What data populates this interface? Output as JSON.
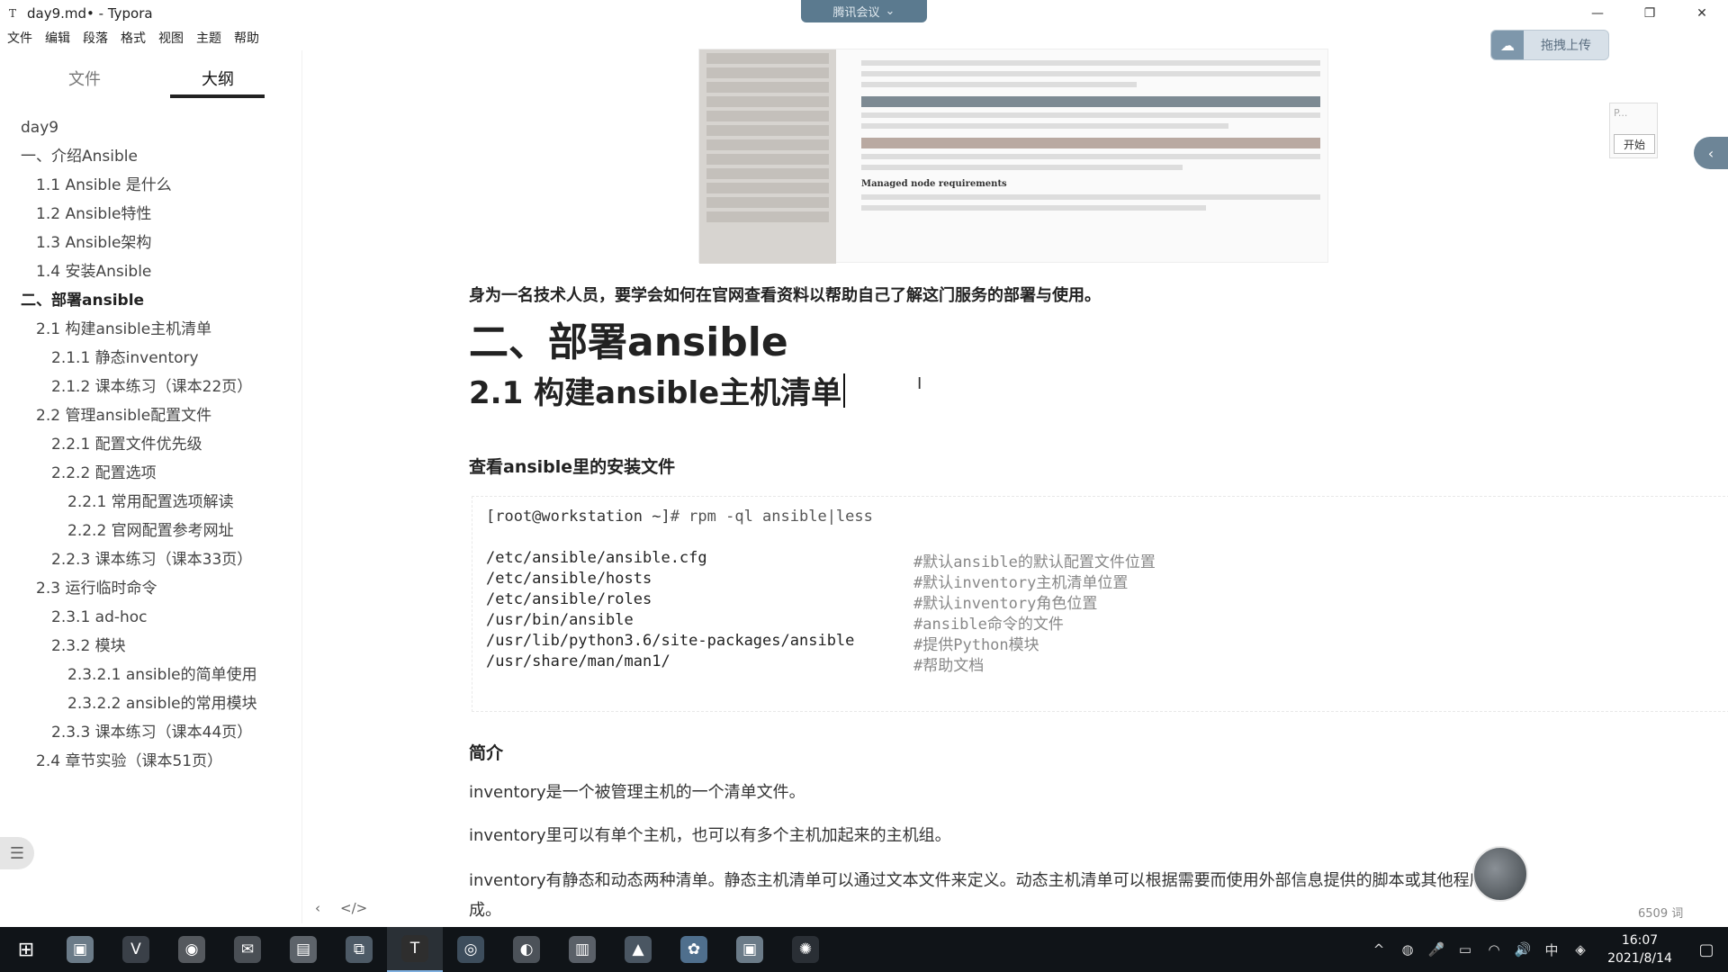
{
  "window": {
    "app_icon": "T",
    "title": "day9.md• - Typora",
    "minimize": "—",
    "maximize": "❐",
    "close": "✕"
  },
  "meeting": {
    "label": "腾讯会议",
    "chevron": "⌄"
  },
  "menubar": [
    "文件",
    "编辑",
    "段落",
    "格式",
    "视图",
    "主题",
    "帮助"
  ],
  "sidebar": {
    "tab_files": "文件",
    "tab_outline": "大纲",
    "outline": [
      {
        "label": "day9",
        "level": 0,
        "bold": false
      },
      {
        "label": "一、介绍Ansible",
        "level": 1,
        "bold": false
      },
      {
        "label": "1.1 Ansible 是什么",
        "level": 2,
        "bold": false
      },
      {
        "label": "1.2 Ansible特性",
        "level": 2,
        "bold": false
      },
      {
        "label": "1.3 Ansible架构",
        "level": 2,
        "bold": false
      },
      {
        "label": "1.4 安装Ansible",
        "level": 2,
        "bold": false
      },
      {
        "label": "二、部署ansible",
        "level": 1,
        "bold": true
      },
      {
        "label": "2.1 构建ansible主机清单",
        "level": 2,
        "bold": false
      },
      {
        "label": "2.1.1 静态inventory",
        "level": 3,
        "bold": false
      },
      {
        "label": "2.1.2 课本练习（课本22页）",
        "level": 3,
        "bold": false
      },
      {
        "label": "2.2 管理ansible配置文件",
        "level": 2,
        "bold": false
      },
      {
        "label": "2.2.1 配置文件优先级",
        "level": 3,
        "bold": false
      },
      {
        "label": "2.2.2 配置选项",
        "level": 3,
        "bold": false
      },
      {
        "label": "2.2.1 常用配置选项解读",
        "level": 4,
        "bold": false
      },
      {
        "label": "2.2.2 官网配置参考网址",
        "level": 4,
        "bold": false
      },
      {
        "label": "2.2.3 课本练习（课本33页）",
        "level": 3,
        "bold": false
      },
      {
        "label": "2.3 运行临时命令",
        "level": 2,
        "bold": false
      },
      {
        "label": "2.3.1 ad-hoc",
        "level": 3,
        "bold": false
      },
      {
        "label": "2.3.2 模块",
        "level": 3,
        "bold": false
      },
      {
        "label": "2.3.2.1 ansible的简单使用",
        "level": 4,
        "bold": false
      },
      {
        "label": "2.3.2.2 ansible的常用模块",
        "level": 4,
        "bold": false
      },
      {
        "label": "2.3.3 课本练习（课本44页）",
        "level": 3,
        "bold": false
      },
      {
        "label": "2.4 章节实验（课本51页）",
        "level": 2,
        "bold": false
      }
    ],
    "toggle_icon": "☰"
  },
  "content": {
    "embed_heading": "Managed node requirements",
    "strong_line": "身为一名技术人员，要学会如何在官网查看资料以帮助自己了解这门服务的部署与使用。",
    "h1": "二、部署ansible",
    "h2": "2.1 构建ansible主机清单",
    "cursor_glyph": "I",
    "h4": "查看ansible里的安装文件",
    "code": {
      "prompt": "[root@workstation ~]",
      "command": "# rpm -ql ansible|less",
      "rows": [
        {
          "path": "/etc/ansible/ansible.cfg",
          "comment": "#默认ansible的默认配置文件位置"
        },
        {
          "path": "/etc/ansible/hosts",
          "comment": "#默认inventory主机清单位置"
        },
        {
          "path": "/etc/ansible/roles",
          "comment": "#默认inventory角色位置"
        },
        {
          "path": "/usr/bin/ansible",
          "comment": "#ansible命令的文件"
        },
        {
          "path": "/usr/lib/python3.6/site-packages/ansible",
          "comment": "#提供Python模块"
        },
        {
          "path": "/usr/share/man/man1/",
          "comment": "#帮助文档"
        }
      ]
    },
    "h4_intro": "简介",
    "p1": "inventory是一个被管理主机的一个清单文件。",
    "p2": "inventory里可以有单个主机，也可以有多个主机加起来的主机组。",
    "p3": "inventory有静态和动态两种清单。静态主机清单可以通过文本文件来定义。动态主机清单可以根据需要而使用外部信息提供的脚本或其他程序来生成。"
  },
  "overlay": {
    "upload_icon": "☁",
    "upload_label": "拖拽上传",
    "mini_placeholder": "P...",
    "start_label": "开始",
    "edge_icon": "‹"
  },
  "footer": {
    "nav_back": "‹",
    "source_toggle": "</>",
    "wordcount": "6509 词"
  },
  "taskbar": {
    "start_icon": "⊞",
    "apps": [
      {
        "name": "app-photo",
        "glyph": "▣",
        "color": "#6b7b88"
      },
      {
        "name": "app-vivaldi",
        "glyph": "V",
        "color": "#3a4048"
      },
      {
        "name": "app-chrome",
        "glyph": "◉",
        "color": "#55595e"
      },
      {
        "name": "app-wechat",
        "glyph": "✉",
        "color": "#4a4f55"
      },
      {
        "name": "app-explorer",
        "glyph": "▤",
        "color": "#5d636a"
      },
      {
        "name": "app-vm",
        "glyph": "⧉",
        "color": "#4d5a66"
      },
      {
        "name": "app-typora",
        "glyph": "T",
        "color": "#2e2e2e"
      },
      {
        "name": "app-terminal",
        "glyph": "◎",
        "color": "#3d4d5c"
      },
      {
        "name": "app-netease",
        "glyph": "◐",
        "color": "#4c5259"
      },
      {
        "name": "app-notes",
        "glyph": "▥",
        "color": "#5a6068"
      },
      {
        "name": "app-image",
        "glyph": "▲",
        "color": "#4a5662"
      },
      {
        "name": "app-meeting",
        "glyph": "✿",
        "color": "#4f6f8d"
      },
      {
        "name": "app-photo2",
        "glyph": "▣",
        "color": "#6b7b88"
      },
      {
        "name": "app-other",
        "glyph": "✺",
        "color": "#2a2f35"
      }
    ],
    "tray": [
      "^",
      "◍",
      "🎤",
      "▭",
      "◠",
      "🔊",
      "中",
      "◈"
    ],
    "time": "16:07",
    "date": "2021/8/14",
    "notif_icon": "▢"
  }
}
